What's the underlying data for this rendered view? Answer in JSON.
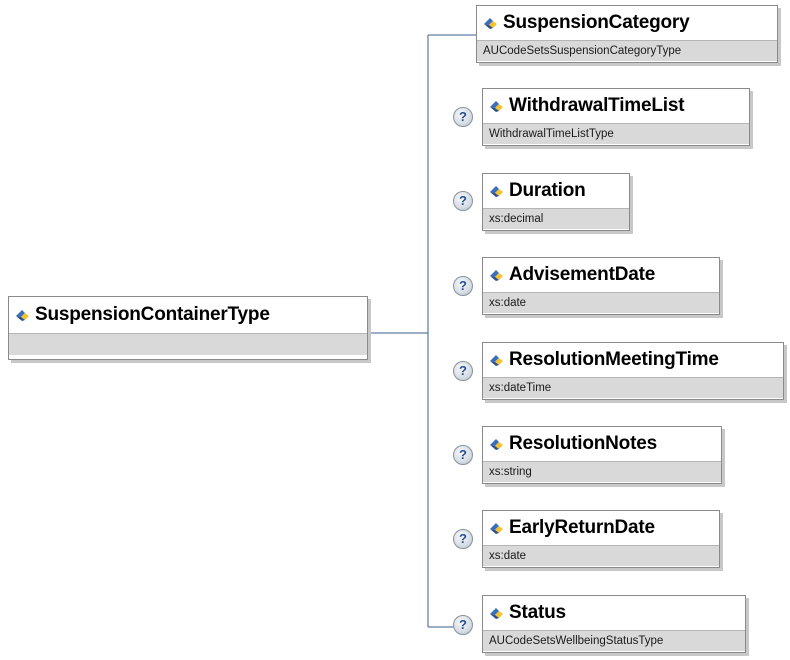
{
  "root": {
    "name": "SuspensionContainerType",
    "type": ""
  },
  "optional_badge": "?",
  "icons": {
    "element": "element-diamond-icon",
    "optional": "optional-question-icon"
  },
  "children": [
    {
      "name": "SuspensionCategory",
      "type": "AUCodeSetsSuspensionCategoryType",
      "optional": false
    },
    {
      "name": "WithdrawalTimeList",
      "type": "WithdrawalTimeListType",
      "optional": true
    },
    {
      "name": "Duration",
      "type": "xs:decimal",
      "optional": true
    },
    {
      "name": "AdvisementDate",
      "type": "xs:date",
      "optional": true
    },
    {
      "name": "ResolutionMeetingTime",
      "type": "xs:dateTime",
      "optional": true
    },
    {
      "name": "ResolutionNotes",
      "type": "xs:string",
      "optional": true
    },
    {
      "name": "EarlyReturnDate",
      "type": "xs:date",
      "optional": true
    },
    {
      "name": "Status",
      "type": "AUCodeSetsWellbeingStatusType",
      "optional": true
    }
  ],
  "colors": {
    "connector": "#3b5f8f",
    "type_band": "#d9d9d9",
    "icon_blue": "#3a6fbf",
    "icon_yellow": "#f2c230"
  }
}
